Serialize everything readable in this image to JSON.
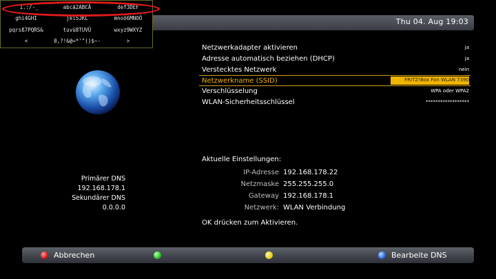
{
  "header": {
    "datetime": "Thu 04. Aug   19:03"
  },
  "settings": [
    {
      "label": "Netzwerkadapter aktivieren",
      "value": "ja"
    },
    {
      "label": "Adresse automatisch beziehen (DHCP)",
      "value": "ja"
    },
    {
      "label": "Verstecktes Netzwerk",
      "value": "nein"
    },
    {
      "label": "Netzwerkname (SSID)",
      "value": "FRITZ!Box Fon WLAN 7390",
      "selected": true
    },
    {
      "label": "Verschlüsselung",
      "value": "WPA oder WPA2"
    },
    {
      "label": "WLAN-Sicherheitsschlüssel",
      "value": "******************"
    }
  ],
  "dns": {
    "primary_label": "Primärer DNS",
    "primary_value": "192.168.178.1",
    "secondary_label": "Sekundärer DNS",
    "secondary_value": "0.0.0.0"
  },
  "current": {
    "title": "Aktuelle Einstellungen:",
    "rows": [
      {
        "key": "IP-Adresse",
        "value": "192.168.178.22"
      },
      {
        "key": "Netzmaske",
        "value": "255.255.255.0"
      },
      {
        "key": "Gateway",
        "value": "192.168.178.1"
      },
      {
        "key": "Netzwerk:",
        "value": "WLAN Verbindung"
      }
    ],
    "hint": "OK drücken zum Aktivieren."
  },
  "buttons": {
    "red": "Abbrechen",
    "green": "",
    "yellow": "",
    "blue": "Bearbeite DNS"
  },
  "keyboard": {
    "rows": [
      [
        "1.:/-_",
        "abcä2ABCÄ",
        "def3DEF"
      ],
      [
        "ghi4GHI",
        "jkl5JKL",
        "mnoö6MNOÖ"
      ],
      [
        "pqrsß7PQRS&",
        "tuvü8TUVÜ",
        "wxyz9WXYZ"
      ],
      [
        "<",
        "0,?!&@=*'\"()$~-",
        ">"
      ]
    ]
  },
  "colors": {
    "highlight": "#f0b400",
    "annotation": "#e21b1b"
  }
}
